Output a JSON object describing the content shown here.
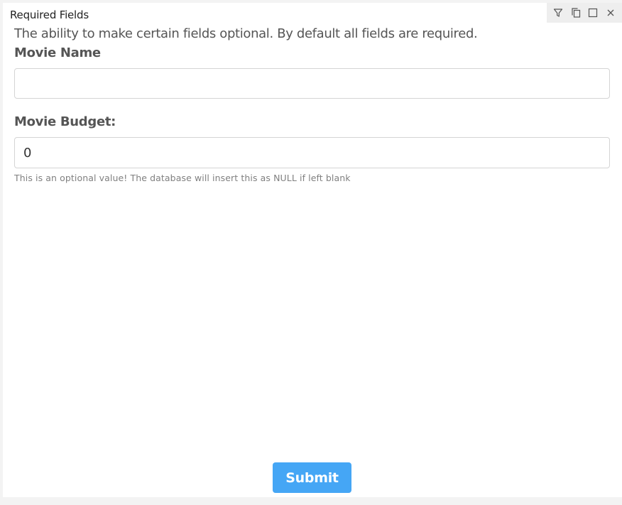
{
  "panel": {
    "title": "Required Fields",
    "toolbar": {
      "icons": [
        "filter-icon",
        "copy-icon",
        "maximize-icon",
        "close-icon"
      ]
    }
  },
  "form": {
    "description": "The ability to make certain fields optional. By default all fields are required.",
    "movie_name": {
      "label": "Movie Name",
      "value": "",
      "placeholder": ""
    },
    "movie_budget": {
      "label": "Movie Budget:",
      "value": "0",
      "help": "This is an optional value! The database will insert this as NULL if left blank"
    },
    "submit_label": "Submit"
  },
  "colors": {
    "accent": "#45a6f5",
    "label": "#555555",
    "help": "#808080",
    "toolbar_bg": "#eeeeee"
  }
}
